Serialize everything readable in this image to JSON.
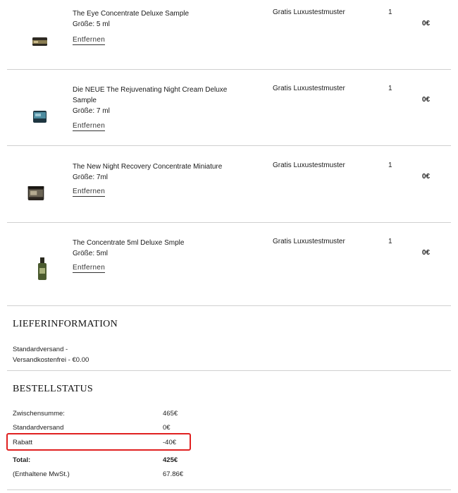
{
  "items": [
    {
      "name": "The Eye Concentrate Deluxe Sample",
      "size": "Größe: 5 ml",
      "remove": "Entfernen",
      "type": "Gratis Luxustestmuster",
      "qty": "1",
      "price": "0€"
    },
    {
      "name": "Die NEUE The Rejuvenating Night Cream Deluxe Sample",
      "size": "Größe: 7 ml",
      "remove": "Entfernen",
      "type": "Gratis Luxustestmuster",
      "qty": "1",
      "price": "0€"
    },
    {
      "name": "The New Night Recovery Concentrate Miniature",
      "size": "Größe: 7ml",
      "remove": "Entfernen",
      "type": "Gratis Luxustestmuster",
      "qty": "1",
      "price": "0€"
    },
    {
      "name": "The Concentrate 5ml Deluxe Smple",
      "size": "Größe: 5ml",
      "remove": "Entfernen",
      "type": "Gratis Luxustestmuster",
      "qty": "1",
      "price": "0€"
    }
  ],
  "shipping": {
    "title": "LIEFERINFORMATION",
    "line1": "Standardversand -",
    "line2": "Versandkostenfrei - €0.00"
  },
  "order": {
    "title": "BESTELLSTATUS",
    "subtotal_label": "Zwischensumme:",
    "subtotal_value": "465€",
    "shipping_label": "Standardversand",
    "shipping_value": "0€",
    "discount_label": "Rabatt",
    "discount_value": "-40€",
    "total_label": "Total:",
    "total_value": "425€",
    "vat_label": "(Enthaltene MwSt.)",
    "vat_value": "67.86€"
  },
  "colors": {
    "highlight": "#e02020"
  }
}
